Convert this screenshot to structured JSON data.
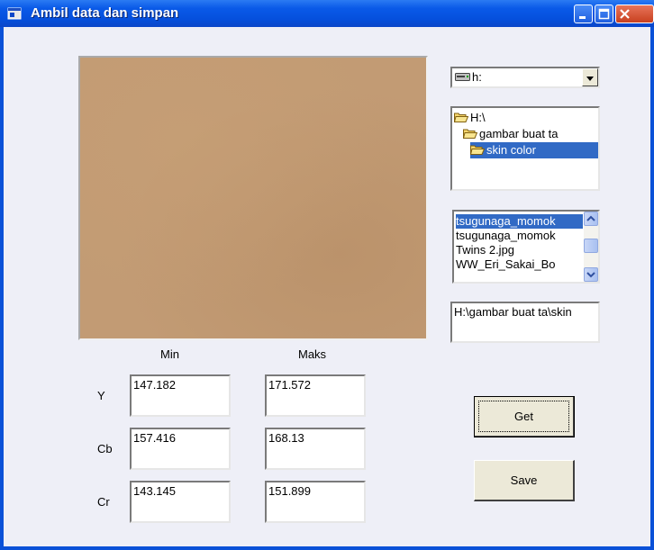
{
  "window": {
    "title": "Ambil data dan simpan"
  },
  "labels": {
    "min": "Min",
    "max": "Maks",
    "y": "Y",
    "cb": "Cb",
    "cr": "Cr"
  },
  "values": {
    "y_min": "147.182",
    "y_max": "171.572",
    "cb_min": "157.416",
    "cb_max": "168.13",
    "cr_min": "143.145",
    "cr_max": "151.899"
  },
  "buttons": {
    "get": "Get",
    "save": "Save"
  },
  "drive": {
    "selected": "h:"
  },
  "directories": [
    {
      "label": "H:\\",
      "selected": false
    },
    {
      "label": "gambar buat ta",
      "selected": false
    },
    {
      "label": "skin color",
      "selected": true
    }
  ],
  "files": [
    {
      "label": "tsugunaga_momok",
      "selected": true
    },
    {
      "label": "tsugunaga_momok",
      "selected": false
    },
    {
      "label": "Twins 2.jpg",
      "selected": false
    },
    {
      "label": "WW_Eri_Sakai_Bo",
      "selected": false
    }
  ],
  "path": "H:\\gambar buat ta\\skin",
  "colors": {
    "title_blue": "#0a5ae8",
    "selection": "#316ac5",
    "swatch": "#c29b74",
    "client_bg": "#eeeff7"
  },
  "icons": [
    "app-icon",
    "minimize-icon",
    "maximize-icon",
    "close-icon",
    "drive-icon",
    "folder-icon",
    "open-folder-icon",
    "scroll-up-icon",
    "scroll-down-icon"
  ]
}
